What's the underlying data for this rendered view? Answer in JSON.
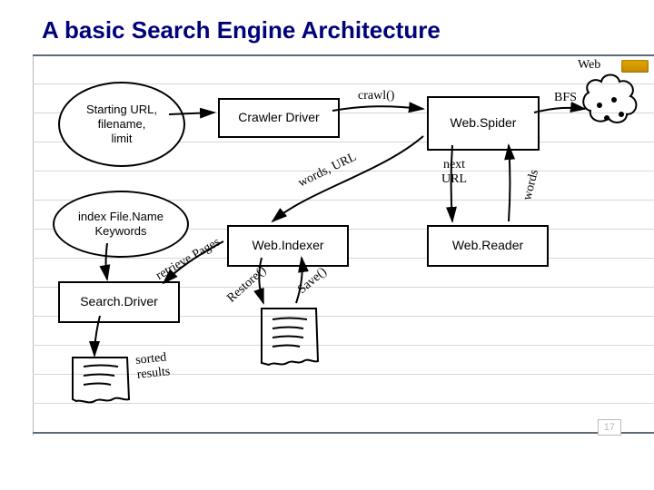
{
  "title": "A basic Search Engine Architecture",
  "page_number": "17",
  "nodes": {
    "start": "Starting URL,\nfilename,\nlimit",
    "crawler_driver": "Crawler Driver",
    "web_spider": "Web.Spider",
    "web_reader": "Web.Reader",
    "web_indexer": "Web.Indexer",
    "index_keywords": "index File.Name\nKeywords",
    "search_driver": "Search.Driver",
    "web": "Web"
  },
  "edge_labels": {
    "crawl": "crawl()",
    "bfs": "BFS",
    "next_url": "next\nURL",
    "words": "words",
    "words_url": "words, URL",
    "retrieve_pages": "retrieve Pages",
    "restore": "Restore()",
    "save": "Save()",
    "sorted_results": "sorted\nresults"
  },
  "theme": {
    "title_color": "#00007a",
    "rule_color": "#d0d8e0",
    "stroke": "#000000"
  }
}
